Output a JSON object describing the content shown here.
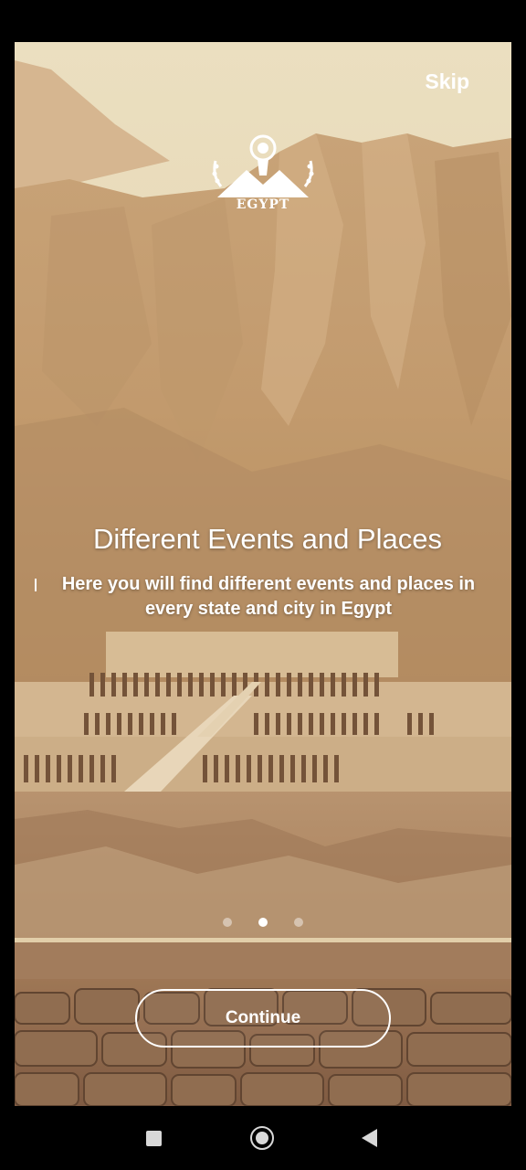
{
  "onboarding": {
    "skip_label": "Skip",
    "logo_text": "EGYPT",
    "title": "Different Events and Places",
    "description": "Here you will find different events and places in every state and city in Egypt",
    "page_indicator": {
      "total": 3,
      "current": 2
    },
    "continue_label": "Continue"
  },
  "navigation_bar": {
    "buttons": [
      "recent-apps",
      "home",
      "back"
    ]
  },
  "colors": {
    "accent": "#ffffff",
    "sand": "#c8a77e",
    "sky": "#ede2c4"
  }
}
